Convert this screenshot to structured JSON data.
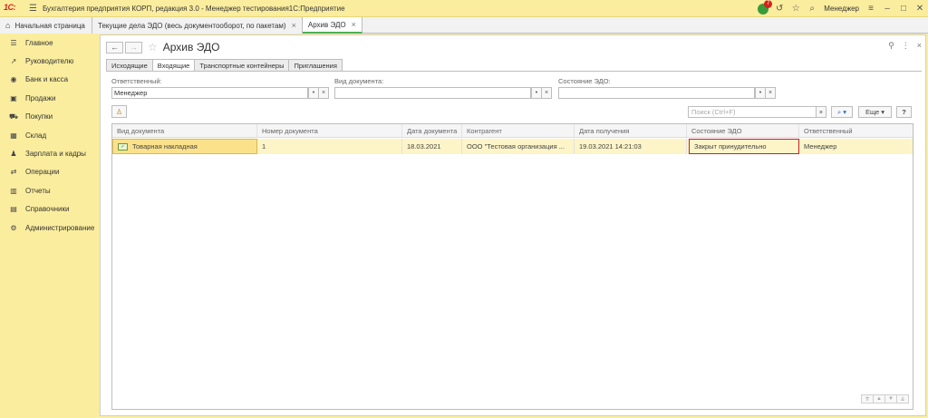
{
  "titlebar": {
    "logo": "1С:",
    "title": "Бухгалтерия предприятия КОРП, редакция 3.0  - Менеджер тестирования1С:Предприятие",
    "notifications": "7",
    "user": "Менеджер"
  },
  "tabs": {
    "home": "Начальная страница",
    "items": [
      {
        "label": "Текущие дела ЭДО (весь документооборот, по пакетам)"
      },
      {
        "label": "Архив ЭДО"
      }
    ]
  },
  "sidebar": {
    "items": [
      {
        "label": "Главное",
        "icon": "menu-icon"
      },
      {
        "label": "Руководителю",
        "icon": "trend-icon"
      },
      {
        "label": "Банк и касса",
        "icon": "coin-icon"
      },
      {
        "label": "Продажи",
        "icon": "sales-icon"
      },
      {
        "label": "Покупки",
        "icon": "cart-icon"
      },
      {
        "label": "Склад",
        "icon": "warehouse-icon"
      },
      {
        "label": "Зарплата и кадры",
        "icon": "people-icon"
      },
      {
        "label": "Операции",
        "icon": "operations-icon"
      },
      {
        "label": "Отчеты",
        "icon": "chart-icon"
      },
      {
        "label": "Справочники",
        "icon": "book-icon"
      },
      {
        "label": "Администрирование",
        "icon": "gear-icon"
      }
    ]
  },
  "page": {
    "title": "Архив ЭДО",
    "form_tabs": [
      "Исходящие",
      "Входящие",
      "Транспортные контейнеры",
      "Приглашения"
    ],
    "active_tab": "Входящие"
  },
  "filters": {
    "responsible_label": "Ответственный:",
    "responsible_value": "Менеджер",
    "doctype_label": "Вид документа:",
    "doctype_value": "",
    "state_label": "Состояние ЭДО:",
    "state_value": ""
  },
  "toolbar": {
    "search_placeholder": "Поиск (Ctrl+F)",
    "more_label": "Еще",
    "help_label": "?"
  },
  "table": {
    "columns": [
      "Вид документа",
      "Номер документа",
      "Дата документа",
      "Контрагент",
      "Дата получения",
      "Состояние ЭДО",
      "Ответственный"
    ],
    "rows": [
      [
        "Товарная накладная",
        "1",
        "18.03.2021",
        "ООО \"Тестовая организация ...",
        "19.03.2021 14:21:03",
        "Закрыт принудительно",
        "Менеджер"
      ]
    ]
  },
  "colors": {
    "sidebar_bg": "#fbed9e",
    "selected_row": "#fdf4c8",
    "highlight_border": "#c8202a",
    "active_tab_underline": "#4caf50"
  }
}
